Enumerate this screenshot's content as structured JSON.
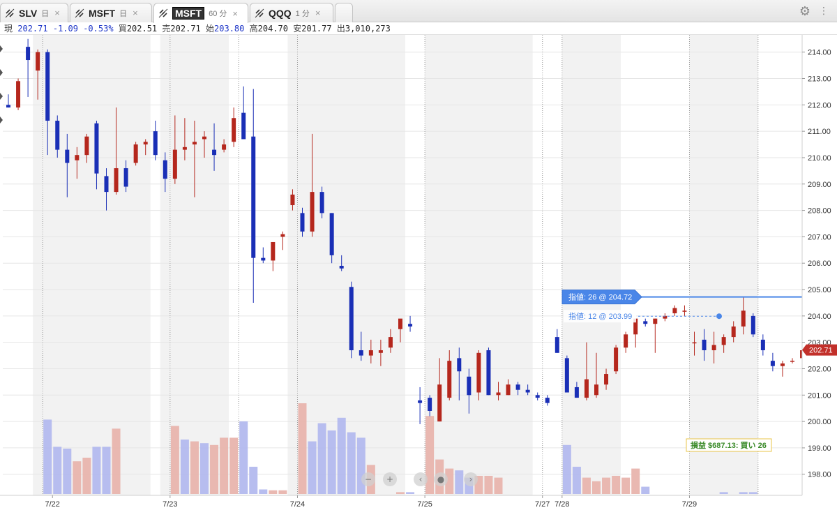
{
  "tabs": [
    {
      "symbol": "SLV",
      "timeframe": "日"
    },
    {
      "symbol": "MSFT",
      "timeframe": "日"
    },
    {
      "symbol": "MSFT",
      "timeframe": "60 分",
      "active": true
    },
    {
      "symbol": "QQQ",
      "timeframe": "1 分"
    }
  ],
  "quote": {
    "last_label": "現",
    "last": "202.71",
    "change": "-1.09",
    "change_pct": "-0.53%",
    "bid_label": "買",
    "bid": "202.51",
    "ask_label": "売",
    "ask": "202.71",
    "open_label": "始",
    "open": "203.80",
    "high_label": "高",
    "high": "204.70",
    "low_label": "安",
    "low": "201.77",
    "volume_label": "出",
    "volume": "3,010,273"
  },
  "colors": {
    "up": "#b5271d",
    "down": "#1a2fb6",
    "up_volume": "#e8b4ad",
    "down_volume": "#b3b9ee",
    "order": "#4a86e8",
    "price_tag": "#c2302a",
    "pnl": "#3a8a2a"
  },
  "chart_data": {
    "type": "candlestick",
    "y_axis": {
      "min": 197.2,
      "max": 214.6,
      "ticks": [
        "214.00",
        "213.00",
        "212.00",
        "211.00",
        "210.00",
        "209.00",
        "208.00",
        "207.00",
        "206.00",
        "205.00",
        "204.00",
        "203.00",
        "202.00",
        "201.00",
        "200.00",
        "199.00",
        "198.00"
      ]
    },
    "x_labels": [
      {
        "label": "7/22",
        "index": 4.5
      },
      {
        "label": "7/23",
        "index": 16.5
      },
      {
        "label": "7/24",
        "index": 29.5
      },
      {
        "label": "7/25",
        "index": 42.5
      },
      {
        "label": "7/27",
        "index": 54.5
      },
      {
        "label": "7/28",
        "index": 56.5
      },
      {
        "label": "7/29",
        "index": 69.5
      }
    ],
    "session_bands": [
      [
        3,
        14
      ],
      [
        16,
        22
      ],
      [
        29,
        40
      ],
      [
        43,
        53
      ],
      [
        57,
        62
      ],
      [
        70,
        76
      ]
    ],
    "day_separators": [
      3.5,
      16.5,
      23.5,
      29.5,
      42.5,
      54.5,
      56.5,
      69.5,
      76.5
    ],
    "candles": [
      {
        "o": 212.0,
        "h": 212.4,
        "l": 211.9,
        "c": 211.9
      },
      {
        "o": 211.9,
        "h": 213.0,
        "l": 211.8,
        "c": 212.9
      },
      {
        "o": 214.2,
        "h": 214.5,
        "l": 212.3,
        "c": 213.7
      },
      {
        "o": 213.3,
        "h": 214.1,
        "l": 212.2,
        "c": 214.0
      },
      {
        "o": 214.0,
        "h": 214.1,
        "l": 210.1,
        "c": 211.4
      },
      {
        "o": 211.4,
        "h": 211.6,
        "l": 210.0,
        "c": 210.3
      },
      {
        "o": 210.3,
        "h": 210.9,
        "l": 208.5,
        "c": 209.8
      },
      {
        "o": 209.9,
        "h": 210.4,
        "l": 209.2,
        "c": 210.1
      },
      {
        "o": 210.1,
        "h": 210.9,
        "l": 209.8,
        "c": 210.8
      },
      {
        "o": 211.3,
        "h": 211.4,
        "l": 208.8,
        "c": 209.4
      },
      {
        "o": 209.3,
        "h": 209.6,
        "l": 208.0,
        "c": 208.7
      },
      {
        "o": 208.7,
        "h": 211.9,
        "l": 208.6,
        "c": 209.6
      },
      {
        "o": 209.6,
        "h": 209.9,
        "l": 208.7,
        "c": 208.9
      },
      {
        "o": 209.8,
        "h": 210.6,
        "l": 209.7,
        "c": 210.5
      },
      {
        "o": 210.5,
        "h": 210.7,
        "l": 210.1,
        "c": 210.6
      },
      {
        "o": 211.0,
        "h": 211.4,
        "l": 209.9,
        "c": 210.1
      },
      {
        "o": 209.9,
        "h": 210.2,
        "l": 208.7,
        "c": 209.2
      },
      {
        "o": 209.2,
        "h": 211.6,
        "l": 209.0,
        "c": 210.3
      },
      {
        "o": 210.3,
        "h": 211.5,
        "l": 209.9,
        "c": 210.4
      },
      {
        "o": 210.5,
        "h": 211.4,
        "l": 208.5,
        "c": 210.6
      },
      {
        "o": 210.7,
        "h": 211.0,
        "l": 210.0,
        "c": 210.8
      },
      {
        "o": 210.3,
        "h": 211.3,
        "l": 209.5,
        "c": 210.1
      },
      {
        "o": 210.3,
        "h": 210.7,
        "l": 210.2,
        "c": 210.5
      },
      {
        "o": 210.6,
        "h": 211.9,
        "l": 210.4,
        "c": 211.5
      },
      {
        "o": 211.7,
        "h": 212.7,
        "l": 210.8,
        "c": 210.7
      },
      {
        "o": 210.8,
        "h": 212.6,
        "l": 204.5,
        "c": 206.2
      },
      {
        "o": 206.2,
        "h": 206.6,
        "l": 206.0,
        "c": 206.1
      },
      {
        "o": 206.1,
        "h": 206.6,
        "l": 205.7,
        "c": 206.8
      },
      {
        "o": 207.0,
        "h": 207.2,
        "l": 206.5,
        "c": 207.1
      },
      {
        "o": 208.2,
        "h": 208.8,
        "l": 208.0,
        "c": 208.6
      },
      {
        "o": 207.9,
        "h": 208.1,
        "l": 207.0,
        "c": 207.2
      },
      {
        "o": 207.2,
        "h": 210.9,
        "l": 207.0,
        "c": 208.7
      },
      {
        "o": 208.7,
        "h": 208.9,
        "l": 207.7,
        "c": 207.9
      },
      {
        "o": 207.9,
        "h": 207.9,
        "l": 206.0,
        "c": 206.3
      },
      {
        "o": 205.9,
        "h": 206.3,
        "l": 205.7,
        "c": 205.8
      },
      {
        "o": 205.1,
        "h": 205.3,
        "l": 202.4,
        "c": 202.7
      },
      {
        "o": 202.7,
        "h": 203.4,
        "l": 202.3,
        "c": 202.5
      },
      {
        "o": 202.5,
        "h": 203.1,
        "l": 202.2,
        "c": 202.7
      },
      {
        "o": 202.6,
        "h": 203.1,
        "l": 202.1,
        "c": 202.7
      },
      {
        "o": 202.8,
        "h": 203.5,
        "l": 202.6,
        "c": 203.2
      },
      {
        "o": 203.5,
        "h": 203.8,
        "l": 203.0,
        "c": 203.9
      },
      {
        "o": 203.7,
        "h": 204.0,
        "l": 203.4,
        "c": 203.6
      },
      {
        "o": 200.8,
        "h": 201.3,
        "l": 199.9,
        "c": 200.7
      },
      {
        "o": 200.9,
        "h": 201.0,
        "l": 200.2,
        "c": 200.4
      },
      {
        "o": 200.0,
        "h": 202.4,
        "l": 200.0,
        "c": 201.4
      },
      {
        "o": 200.9,
        "h": 202.7,
        "l": 200.8,
        "c": 202.3
      },
      {
        "o": 202.4,
        "h": 202.8,
        "l": 200.8,
        "c": 201.9
      },
      {
        "o": 201.7,
        "h": 202.0,
        "l": 200.3,
        "c": 201.0
      },
      {
        "o": 201.1,
        "h": 202.7,
        "l": 200.8,
        "c": 202.6
      },
      {
        "o": 202.7,
        "h": 202.8,
        "l": 201.0,
        "c": 201.0
      },
      {
        "o": 201.0,
        "h": 201.5,
        "l": 200.8,
        "c": 201.1
      },
      {
        "o": 201.0,
        "h": 201.6,
        "l": 201.0,
        "c": 201.4
      },
      {
        "o": 201.4,
        "h": 201.5,
        "l": 201.0,
        "c": 201.2
      },
      {
        "o": 201.2,
        "h": 201.4,
        "l": 201.0,
        "c": 201.1
      },
      {
        "o": 201.0,
        "h": 201.1,
        "l": 200.8,
        "c": 200.9
      },
      {
        "o": 200.9,
        "h": 201.0,
        "l": 200.6,
        "c": 200.7
      },
      {
        "o": 203.2,
        "h": 203.5,
        "l": 202.6,
        "c": 202.6
      },
      {
        "o": 202.4,
        "h": 202.5,
        "l": 201.1,
        "c": 201.1
      },
      {
        "o": 201.3,
        "h": 201.5,
        "l": 200.9,
        "c": 200.9
      },
      {
        "o": 200.9,
        "h": 203.0,
        "l": 200.8,
        "c": 201.6
      },
      {
        "o": 201.0,
        "h": 202.6,
        "l": 200.9,
        "c": 201.4
      },
      {
        "o": 201.4,
        "h": 202.0,
        "l": 201.2,
        "c": 201.8
      },
      {
        "o": 201.9,
        "h": 202.9,
        "l": 201.8,
        "c": 202.8
      },
      {
        "o": 202.8,
        "h": 203.4,
        "l": 202.6,
        "c": 203.3
      },
      {
        "o": 203.3,
        "h": 203.9,
        "l": 202.8,
        "c": 203.9
      },
      {
        "o": 203.8,
        "h": 203.9,
        "l": 203.6,
        "c": 203.7
      },
      {
        "o": 203.7,
        "h": 203.9,
        "l": 202.6,
        "c": 203.9
      },
      {
        "o": 203.9,
        "h": 204.1,
        "l": 203.8,
        "c": 204.0
      },
      {
        "o": 204.1,
        "h": 204.4,
        "l": 204.0,
        "c": 204.3
      },
      {
        "o": 204.2,
        "h": 204.4,
        "l": 204.0,
        "c": 204.2
      },
      {
        "o": 203.0,
        "h": 203.4,
        "l": 202.5,
        "c": 203.0
      },
      {
        "o": 203.1,
        "h": 203.5,
        "l": 202.3,
        "c": 202.7
      },
      {
        "o": 202.7,
        "h": 203.4,
        "l": 202.2,
        "c": 202.9
      },
      {
        "o": 202.9,
        "h": 203.3,
        "l": 202.6,
        "c": 203.2
      },
      {
        "o": 203.2,
        "h": 203.8,
        "l": 203.0,
        "c": 203.6
      },
      {
        "o": 203.6,
        "h": 204.7,
        "l": 203.3,
        "c": 204.2
      },
      {
        "o": 204.0,
        "h": 204.1,
        "l": 203.2,
        "c": 203.3
      },
      {
        "o": 203.1,
        "h": 203.3,
        "l": 202.5,
        "c": 202.7
      },
      {
        "o": 202.3,
        "h": 202.6,
        "l": 201.9,
        "c": 202.1
      },
      {
        "o": 202.1,
        "h": 202.3,
        "l": 201.7,
        "c": 202.2
      },
      {
        "o": 202.3,
        "h": 202.4,
        "l": 202.2,
        "c": 202.3
      },
      {
        "o": 202.4,
        "h": 202.8,
        "l": 202.4,
        "c": 202.7
      }
    ],
    "volume_relative": [
      0.02,
      0.02,
      0.02,
      0.02,
      0.82,
      0.55,
      0.52,
      0.38,
      0.4,
      0.55,
      0.55,
      0.77,
      0.02,
      0.02,
      0.02,
      0.02,
      0.02,
      0.02,
      0.02,
      0.02,
      0.85,
      0.7,
      0.63,
      0.62,
      0.57,
      0.65,
      0.7,
      0.7,
      0.92,
      0.02,
      0.02,
      0.02,
      0.02,
      0.02,
      0.02,
      0.02,
      0.02,
      0.02,
      0.02,
      0.02,
      0.02,
      0.02,
      0.02,
      0.02,
      0.02,
      0.02,
      0.02,
      0.02,
      0.02,
      0.02,
      0.02,
      0.02,
      0.02,
      0.02,
      0.02,
      0.02,
      0.02,
      0.02,
      0.02,
      0.02,
      0.02,
      0.02,
      0.02,
      0.02,
      0.02,
      0.02,
      0.02,
      0.02,
      0.02,
      0.02,
      0.02,
      0.02,
      0.02,
      0.02,
      0.02,
      0.02,
      0.02,
      0.02,
      0.02,
      0.02,
      0.02,
      0.02
    ],
    "volume_bars": [
      {
        "i": 4,
        "v": 0.82,
        "d": "down"
      },
      {
        "i": 5,
        "v": 0.52,
        "d": "down"
      },
      {
        "i": 6,
        "v": 0.5,
        "d": "down"
      },
      {
        "i": 7,
        "v": 0.36,
        "d": "up"
      },
      {
        "i": 8,
        "v": 0.4,
        "d": "up"
      },
      {
        "i": 9,
        "v": 0.52,
        "d": "down"
      },
      {
        "i": 10,
        "v": 0.52,
        "d": "down"
      },
      {
        "i": 11,
        "v": 0.72,
        "d": "up"
      },
      {
        "i": 17,
        "v": 0.75,
        "d": "up"
      },
      {
        "i": 18,
        "v": 0.6,
        "d": "down"
      },
      {
        "i": 19,
        "v": 0.58,
        "d": "up"
      },
      {
        "i": 20,
        "v": 0.56,
        "d": "down"
      },
      {
        "i": 21,
        "v": 0.54,
        "d": "up"
      },
      {
        "i": 22,
        "v": 0.62,
        "d": "up"
      },
      {
        "i": 23,
        "v": 0.62,
        "d": "up"
      },
      {
        "i": 24,
        "v": 0.8,
        "d": "down"
      },
      {
        "i": 25,
        "v": 0.3,
        "d": "down"
      },
      {
        "i": 26,
        "v": 0.05,
        "d": "down"
      },
      {
        "i": 27,
        "v": 0.04,
        "d": "up"
      },
      {
        "i": 28,
        "v": 0.04,
        "d": "up"
      },
      {
        "i": 30,
        "v": 1.0,
        "d": "up"
      },
      {
        "i": 31,
        "v": 0.58,
        "d": "down"
      },
      {
        "i": 32,
        "v": 0.78,
        "d": "down"
      },
      {
        "i": 33,
        "v": 0.7,
        "d": "down"
      },
      {
        "i": 34,
        "v": 0.84,
        "d": "down"
      },
      {
        "i": 35,
        "v": 0.68,
        "d": "down"
      },
      {
        "i": 36,
        "v": 0.62,
        "d": "down"
      },
      {
        "i": 37,
        "v": 0.32,
        "d": "up"
      },
      {
        "i": 40,
        "v": 0.02,
        "d": "up"
      },
      {
        "i": 41,
        "v": 0.02,
        "d": "down"
      },
      {
        "i": 43,
        "v": 0.86,
        "d": "up"
      },
      {
        "i": 44,
        "v": 0.38,
        "d": "up"
      },
      {
        "i": 45,
        "v": 0.28,
        "d": "up"
      },
      {
        "i": 46,
        "v": 0.26,
        "d": "down"
      },
      {
        "i": 47,
        "v": 0.18,
        "d": "down"
      },
      {
        "i": 48,
        "v": 0.2,
        "d": "up"
      },
      {
        "i": 49,
        "v": 0.2,
        "d": "up"
      },
      {
        "i": 50,
        "v": 0.18,
        "d": "up"
      },
      {
        "i": 57,
        "v": 0.54,
        "d": "down"
      },
      {
        "i": 58,
        "v": 0.3,
        "d": "down"
      },
      {
        "i": 59,
        "v": 0.18,
        "d": "up"
      },
      {
        "i": 60,
        "v": 0.14,
        "d": "up"
      },
      {
        "i": 61,
        "v": 0.18,
        "d": "up"
      },
      {
        "i": 62,
        "v": 0.2,
        "d": "up"
      },
      {
        "i": 63,
        "v": 0.18,
        "d": "up"
      },
      {
        "i": 64,
        "v": 0.28,
        "d": "up"
      },
      {
        "i": 65,
        "v": 0.08,
        "d": "down"
      },
      {
        "i": 73,
        "v": 0.02,
        "d": "down"
      },
      {
        "i": 75,
        "v": 0.02,
        "d": "down"
      },
      {
        "i": 76,
        "v": 0.02,
        "d": "down"
      }
    ],
    "orders": [
      {
        "label": "指値: 26 @ 204.72",
        "price": 204.72,
        "style": "solid"
      },
      {
        "label": "指値: 12 @ 203.99",
        "price": 203.99,
        "style": "dashed"
      }
    ],
    "last_price_tag": "202.71",
    "pnl_label": "損益 $687.13: 買い 26"
  }
}
